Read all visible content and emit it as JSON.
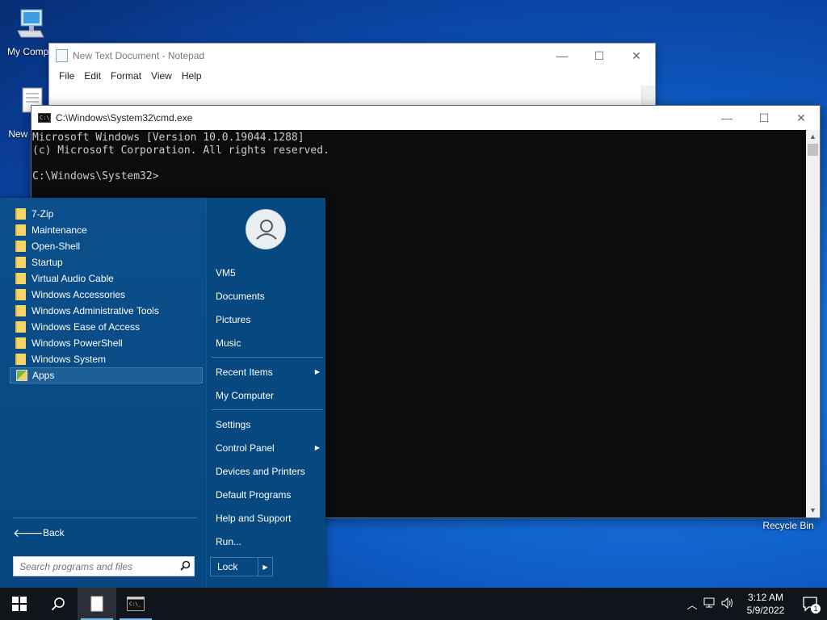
{
  "desktop": {
    "icons": [
      {
        "label": "My Compu",
        "icon": "computer-icon"
      },
      {
        "label": "New Docu",
        "icon": "text-document-icon"
      },
      {
        "label": "Recycle Bin",
        "icon": "recycle-bin-icon"
      }
    ]
  },
  "notepad": {
    "title": "New Text Document - Notepad",
    "menu": [
      "File",
      "Edit",
      "Format",
      "View",
      "Help"
    ]
  },
  "cmd": {
    "title": "C:\\Windows\\System32\\cmd.exe",
    "icon_text": "C:\\_",
    "lines": [
      "Microsoft Windows [Version 10.0.19044.1288]",
      "(c) Microsoft Corporation. All rights reserved.",
      "",
      "C:\\Windows\\System32>"
    ]
  },
  "window_controls": {
    "minimize": "—",
    "maximize": "☐",
    "close": "✕"
  },
  "start_menu": {
    "programs": [
      {
        "label": "7-Zip"
      },
      {
        "label": "Maintenance"
      },
      {
        "label": "Open-Shell"
      },
      {
        "label": "Startup"
      },
      {
        "label": "Virtual Audio Cable"
      },
      {
        "label": "Windows Accessories"
      },
      {
        "label": "Windows Administrative Tools"
      },
      {
        "label": "Windows Ease of Access"
      },
      {
        "label": "Windows PowerShell"
      },
      {
        "label": "Windows System"
      },
      {
        "label": "Apps"
      }
    ],
    "back_label": "Back",
    "search_placeholder": "Search programs and files",
    "right": {
      "user": "VM5",
      "group1": [
        "Documents",
        "Pictures",
        "Music"
      ],
      "group2": [
        {
          "label": "Recent Items",
          "submenu": true
        },
        {
          "label": "My Computer",
          "submenu": false
        }
      ],
      "group3": [
        {
          "label": "Settings",
          "submenu": false
        },
        {
          "label": "Control Panel",
          "submenu": true
        },
        {
          "label": "Devices and Printers",
          "submenu": false
        },
        {
          "label": "Default Programs",
          "submenu": false
        },
        {
          "label": "Help and Support",
          "submenu": false
        },
        {
          "label": "Run...",
          "submenu": false
        }
      ],
      "lock_label": "Lock"
    }
  },
  "taskbar": {
    "time": "3:12 AM",
    "date": "5/9/2022",
    "notification_count": "1"
  },
  "colors": {
    "start_menu_bg": "#07457d",
    "taskbar_bg": "#11151b",
    "selection": "#1d5e96"
  }
}
